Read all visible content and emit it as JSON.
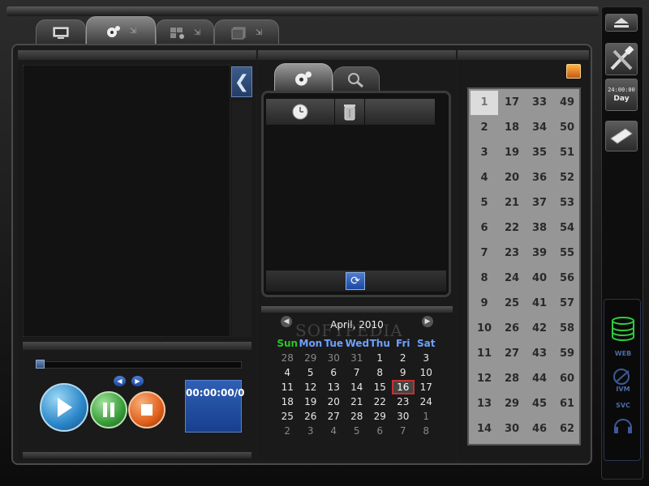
{
  "tabs": [
    {
      "icon": "monitor-icon"
    },
    {
      "icon": "camera-reel-icon",
      "active": true
    },
    {
      "icon": "grid-camera-icon"
    },
    {
      "icon": "layers-icon"
    }
  ],
  "player": {
    "time": "00:00:00/0",
    "progress": 0.0,
    "buttons": {
      "play": "play-icon",
      "pause": "pause-icon",
      "stop": "stop-icon"
    }
  },
  "search_tabs": [
    {
      "icon": "camera-reel-icon",
      "active": true
    },
    {
      "icon": "magnifier-icon"
    }
  ],
  "list_columns": [
    {
      "icon": "clock-icon"
    },
    {
      "icon": "trash-icon"
    },
    {
      "icon": ""
    }
  ],
  "calendar": {
    "title": "April, 2010",
    "watermark": "SOFTPEDIA",
    "watermark_url": "www.softpedia.com",
    "weekdays": [
      "Sun",
      "Mon",
      "Tue",
      "Wed",
      "Thu",
      "Fri",
      "Sat"
    ],
    "weeks": [
      [
        "28",
        "29",
        "30",
        "31",
        "1",
        "2",
        "3"
      ],
      [
        "4",
        "5",
        "6",
        "7",
        "8",
        "9",
        "10"
      ],
      [
        "11",
        "12",
        "13",
        "14",
        "15",
        "16",
        "17"
      ],
      [
        "18",
        "19",
        "20",
        "21",
        "22",
        "23",
        "24"
      ],
      [
        "25",
        "26",
        "27",
        "28",
        "29",
        "30",
        "1"
      ],
      [
        "2",
        "3",
        "4",
        "5",
        "6",
        "7",
        "8"
      ]
    ],
    "today": "16"
  },
  "channels": {
    "columns": [
      [
        "1",
        "2",
        "3",
        "4",
        "5",
        "6",
        "7",
        "8",
        "9",
        "10",
        "11",
        "12",
        "13",
        "14"
      ],
      [
        "17",
        "18",
        "19",
        "20",
        "21",
        "22",
        "23",
        "24",
        "25",
        "26",
        "27",
        "28",
        "29",
        "30"
      ],
      [
        "33",
        "34",
        "35",
        "36",
        "37",
        "38",
        "39",
        "40",
        "41",
        "42",
        "43",
        "44",
        "45",
        "46"
      ],
      [
        "49",
        "50",
        "51",
        "52",
        "53",
        "54",
        "55",
        "56",
        "57",
        "58",
        "59",
        "60",
        "61",
        "62"
      ]
    ],
    "selected": "1"
  },
  "toolbar": {
    "eject": "eject-icon",
    "tools": "tools-icon",
    "clock_time": "24:00:00",
    "clock_mode": "Day",
    "book": "notebook-icon",
    "db_label": "WEB",
    "db2_label": "IVM",
    "svc_label": "SVC"
  },
  "colors": {
    "accent_blue": "#2f5fb5",
    "play": "#2a86c8",
    "pause": "#3a9c3a",
    "stop": "#e0601c",
    "today_border": "#c73030",
    "sunday": "#29c629",
    "weekday": "#6ea0ff"
  }
}
